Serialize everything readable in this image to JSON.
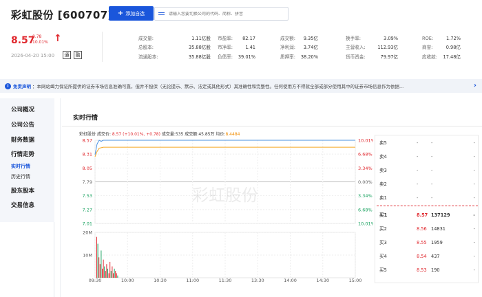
{
  "header": {
    "title": "彩虹股份 [600707]",
    "add_button": "添加自选",
    "search_placeholder": "请输入您要切换公司的代码、简称、拼音"
  },
  "quote": {
    "price": "8.57",
    "change": "0.78",
    "change_pct": "10.01%",
    "datetime": "2026-04-20 15:00",
    "tag1": "通",
    "tag2": "融"
  },
  "stats": [
    {
      "label": "成交量:",
      "value": "1.11亿股"
    },
    {
      "label": "总股本:",
      "value": "35.88亿股"
    },
    {
      "label": "流通股本:",
      "value": "35.88亿股"
    },
    {
      "label": "市盈率:",
      "value": "82.17"
    },
    {
      "label": "市净率:",
      "value": "1.41"
    },
    {
      "label": "负债率:",
      "value": "39.01%"
    },
    {
      "label": "成交额:",
      "value": "9.35亿"
    },
    {
      "label": "净利润:",
      "value": "3.74亿"
    },
    {
      "label": "质押率:",
      "value": "38.20%"
    },
    {
      "label": "换手率:",
      "value": "3.09%"
    },
    {
      "label": "主营收入:",
      "value": "112.93亿"
    },
    {
      "label": "货币资金:",
      "value": "79.97亿"
    },
    {
      "label": "ROE:",
      "value": "1.72%"
    },
    {
      "label": "商誉:",
      "value": "0.98亿"
    },
    {
      "label": "应收款:",
      "value": "17.48亿"
    }
  ],
  "disclaimer": {
    "label": "免责声明",
    "text": "：本网站竭力保证所提供的证券市场信息准确可靠，但并不担保（无论提示、默示、法定或其他形式）其准确性和完整性。任何使用方不得就全部或部分使用其中的证券市场信息作为依据..."
  },
  "sidebar": {
    "items": [
      "公司概况",
      "公司公告",
      "财务数据",
      "行情走势"
    ],
    "sub_items": [
      "实时行情",
      "历史行情"
    ],
    "items2": [
      "股东股本",
      "交易信息"
    ]
  },
  "section_title": "实时行情",
  "chart_info": {
    "name": "彩虹股份",
    "price_label": "成交价:",
    "price_value": "8.57 (+10.01%, +0.78)",
    "volume_label": "成交量:",
    "volume_value": "535",
    "amount_label": "成交额:",
    "amount_value": "45.85万",
    "avg_label": "均价:",
    "avg_value": "8.4484"
  },
  "chart_data": {
    "type": "line",
    "prev_close": 7.79,
    "y_ticks_left": [
      "8.57",
      "8.31",
      "8.05",
      "7.79",
      "7.53",
      "7.27",
      "7.01"
    ],
    "y_ticks_right": [
      "10.01%",
      "6.68%",
      "3.34%",
      "0.00%",
      "3.34%",
      "6.68%",
      "10.01%"
    ],
    "ylim": [
      7.01,
      8.57
    ],
    "vol_ticks": [
      "20M",
      "10M"
    ],
    "vol_ylim": [
      0,
      20
    ],
    "x_ticks": [
      "09:30",
      "10:00",
      "10:30",
      "11:00",
      "11:30",
      "13:30",
      "14:00",
      "14:30",
      "15:00"
    ],
    "series": [
      {
        "name": "成交价",
        "color": "#4a90e2",
        "values": [
          8.3,
          8.5,
          8.57,
          8.55,
          8.57,
          8.57,
          8.57,
          8.57,
          8.57,
          8.57,
          8.57,
          8.57,
          8.57
        ]
      },
      {
        "name": "均价",
        "color": "#f5a623",
        "values": [
          8.26,
          8.36,
          8.42,
          8.43,
          8.44,
          8.44,
          8.44,
          8.44,
          8.44,
          8.44,
          8.44,
          8.44,
          8.44
        ]
      }
    ],
    "volumes": [
      18,
      15,
      9,
      6,
      12,
      4,
      8,
      5,
      3,
      6,
      4,
      2,
      7,
      3,
      5,
      2,
      4,
      3,
      2,
      1
    ]
  },
  "order_book": {
    "sell": [
      {
        "label": "卖5",
        "price": "-",
        "volume": "-",
        "extra": "-"
      },
      {
        "label": "卖4",
        "price": "-",
        "volume": "-",
        "extra": "-"
      },
      {
        "label": "卖3",
        "price": "-",
        "volume": "-",
        "extra": "-"
      },
      {
        "label": "卖2",
        "price": "-",
        "volume": "-",
        "extra": "-"
      },
      {
        "label": "卖1",
        "price": "-",
        "volume": "-",
        "extra": "-"
      }
    ],
    "buy": [
      {
        "label": "买1",
        "price": "8.57",
        "volume": "137129",
        "extra": "-"
      },
      {
        "label": "买2",
        "price": "8.56",
        "volume": "14831",
        "extra": "-"
      },
      {
        "label": "买3",
        "price": "8.55",
        "volume": "1959",
        "extra": "-"
      },
      {
        "label": "买4",
        "price": "8.54",
        "volume": "437",
        "extra": "-"
      },
      {
        "label": "买5",
        "price": "8.53",
        "volume": "190",
        "extra": "-"
      }
    ]
  },
  "colors": {
    "up": "#e0282e",
    "down": "#1aa260",
    "accent": "#1a56db"
  },
  "watermark": "彩虹股份"
}
